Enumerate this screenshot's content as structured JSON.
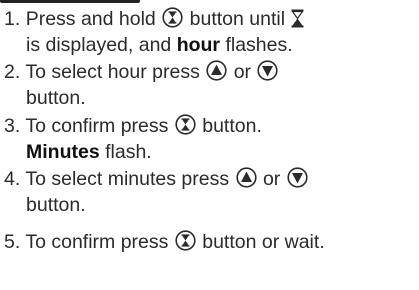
{
  "steps": [
    {
      "number": "1.",
      "text_a": "Press and hold",
      "text_b": "button until",
      "line2_text": "is displayed, and",
      "line2_bold": "hour",
      "line2_end": "flashes."
    },
    {
      "number": "2.",
      "text_a": "To select hour press",
      "text_b": "or",
      "line2_text": "button."
    },
    {
      "number": "3.",
      "text_a": "To confirm press",
      "text_b": "button.",
      "line2_bold": "Minutes",
      "line2_end": "flash."
    },
    {
      "number": "4.",
      "text_a": "To select minutes press",
      "text_b": "or",
      "line2_text": "button."
    },
    {
      "number": "5.",
      "text_a": "To confirm press",
      "text_b": "button or wait."
    }
  ],
  "icons": {
    "timer_button": "hourglass-button-icon",
    "hourglass_symbol": "hourglass-icon",
    "up_button": "up-arrow-button-icon",
    "down_button": "down-arrow-button-icon"
  }
}
